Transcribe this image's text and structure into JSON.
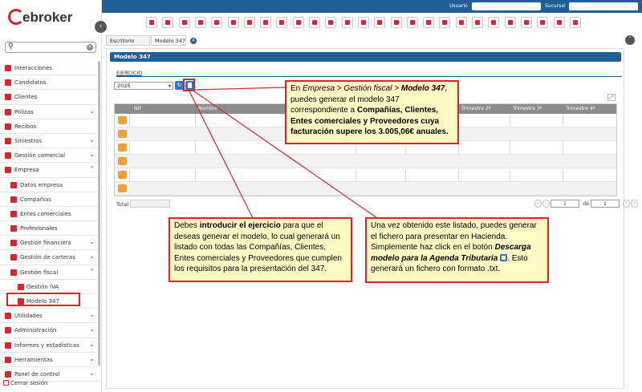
{
  "topbar": {
    "usuario_label": "Usuario",
    "sucursal_label": "Sucursal"
  },
  "logo": {
    "text": "ebroker"
  },
  "search": {
    "placeholder": ""
  },
  "sidebar": {
    "items": [
      {
        "label": "Interacciones",
        "icon": "chat-icon",
        "level": 0,
        "expandable": false
      },
      {
        "label": "Candidatos",
        "icon": "user-plus-icon",
        "level": 0,
        "expandable": false
      },
      {
        "label": "Clientes",
        "icon": "user-icon",
        "level": 0,
        "expandable": false
      },
      {
        "label": "Pólizas",
        "icon": "document-icon",
        "level": 0,
        "expandable": true,
        "expanded": false
      },
      {
        "label": "Recibos",
        "icon": "receipt-icon",
        "level": 0,
        "expandable": false
      },
      {
        "label": "Siniestros",
        "icon": "fire-icon",
        "level": 0,
        "expandable": true,
        "expanded": false
      },
      {
        "label": "Gestión comercial",
        "icon": "cart-icon",
        "level": 0,
        "expandable": true,
        "expanded": false
      },
      {
        "label": "Empresa",
        "icon": "building-icon",
        "level": 0,
        "expandable": true,
        "expanded": true
      },
      {
        "label": "Datos empresa",
        "icon": "edit-icon",
        "level": 1,
        "expandable": false
      },
      {
        "label": "Compañías",
        "icon": "company-icon",
        "level": 1,
        "expandable": false
      },
      {
        "label": "Entes comerciales",
        "icon": "user-icon",
        "level": 1,
        "expandable": false
      },
      {
        "label": "Profesionales",
        "icon": "professional-icon",
        "level": 1,
        "expandable": false
      },
      {
        "label": "Gestión financiera",
        "icon": "finance-icon",
        "level": 1,
        "expandable": true,
        "expanded": false
      },
      {
        "label": "Gestión de carteras",
        "icon": "portfolio-icon",
        "level": 1,
        "expandable": true,
        "expanded": false
      },
      {
        "label": "Gestión fiscal",
        "icon": "fiscal-icon",
        "level": 1,
        "expandable": true,
        "expanded": true
      },
      {
        "label": "Gestión IVA",
        "icon": "percent-icon",
        "level": 2,
        "expandable": false
      },
      {
        "label": "Modelo 347",
        "icon": "document-icon",
        "level": 2,
        "expandable": false,
        "active": true
      },
      {
        "label": "Utilidades",
        "icon": "tools-icon",
        "level": 0,
        "expandable": true,
        "expanded": false
      },
      {
        "label": "Administración",
        "icon": "admin-icon",
        "level": 0,
        "expandable": true,
        "expanded": false
      },
      {
        "label": "Informes y estadísticas",
        "icon": "stats-icon",
        "level": 0,
        "expandable": true,
        "expanded": false
      },
      {
        "label": "Herramientas",
        "icon": "gear-icon",
        "level": 0,
        "expandable": true,
        "expanded": false
      },
      {
        "label": "Panel de control",
        "icon": "dashboard-icon",
        "level": 0,
        "expandable": true,
        "expanded": false
      }
    ],
    "logout_label": "Cerrar sesión"
  },
  "tabs": [
    {
      "label": "Escritorio"
    },
    {
      "label": "Modelo 347",
      "closable": true
    }
  ],
  "panel": {
    "title": "Modelo 347",
    "ejercicio_label": "EJERCICIO",
    "year_value": "2025"
  },
  "table": {
    "columns": [
      "NIF",
      "Nombre",
      "Trimestre 2º",
      "Trimestre 3º",
      "Trimestre 4º"
    ],
    "row_count": 6,
    "total_label": "Total",
    "page_value": "1",
    "page_of": "de",
    "page_total": "1"
  },
  "callouts": {
    "c1": {
      "p1": "En ",
      "i1": "Empresa > Gestión fiscal > ",
      "b1": "Modelo 347",
      "p2": ", puedes generar el modelo 347 correspondiente a ",
      "b2": "Compañías, Clientes, Entes comerciales y Proveedores cuya facturación supere los 3.005,06€ anuales."
    },
    "c2": {
      "p1": "Debes ",
      "b1": "introducir el ejercicio",
      "p2": " para que el deseas generar el modelo, lo cual generará un listado con todas las Compañías, Clientes, Entes comerciales y Proveedores que cumplen los requisitos para la presentación del 347."
    },
    "c3": {
      "p1": "Una vez obtenido este listado, puedes generar el fichero para presentar en Hacienda. Simplemente haz click en el botón ",
      "b1": "Descarga modelo para la Agenda Tributaria",
      "p2": ". Esto generará un fichero con formato .txt."
    }
  },
  "colors": {
    "primary": "#1f5f96",
    "accent": "#d9242b",
    "callout_bg": "#fff9c4"
  }
}
